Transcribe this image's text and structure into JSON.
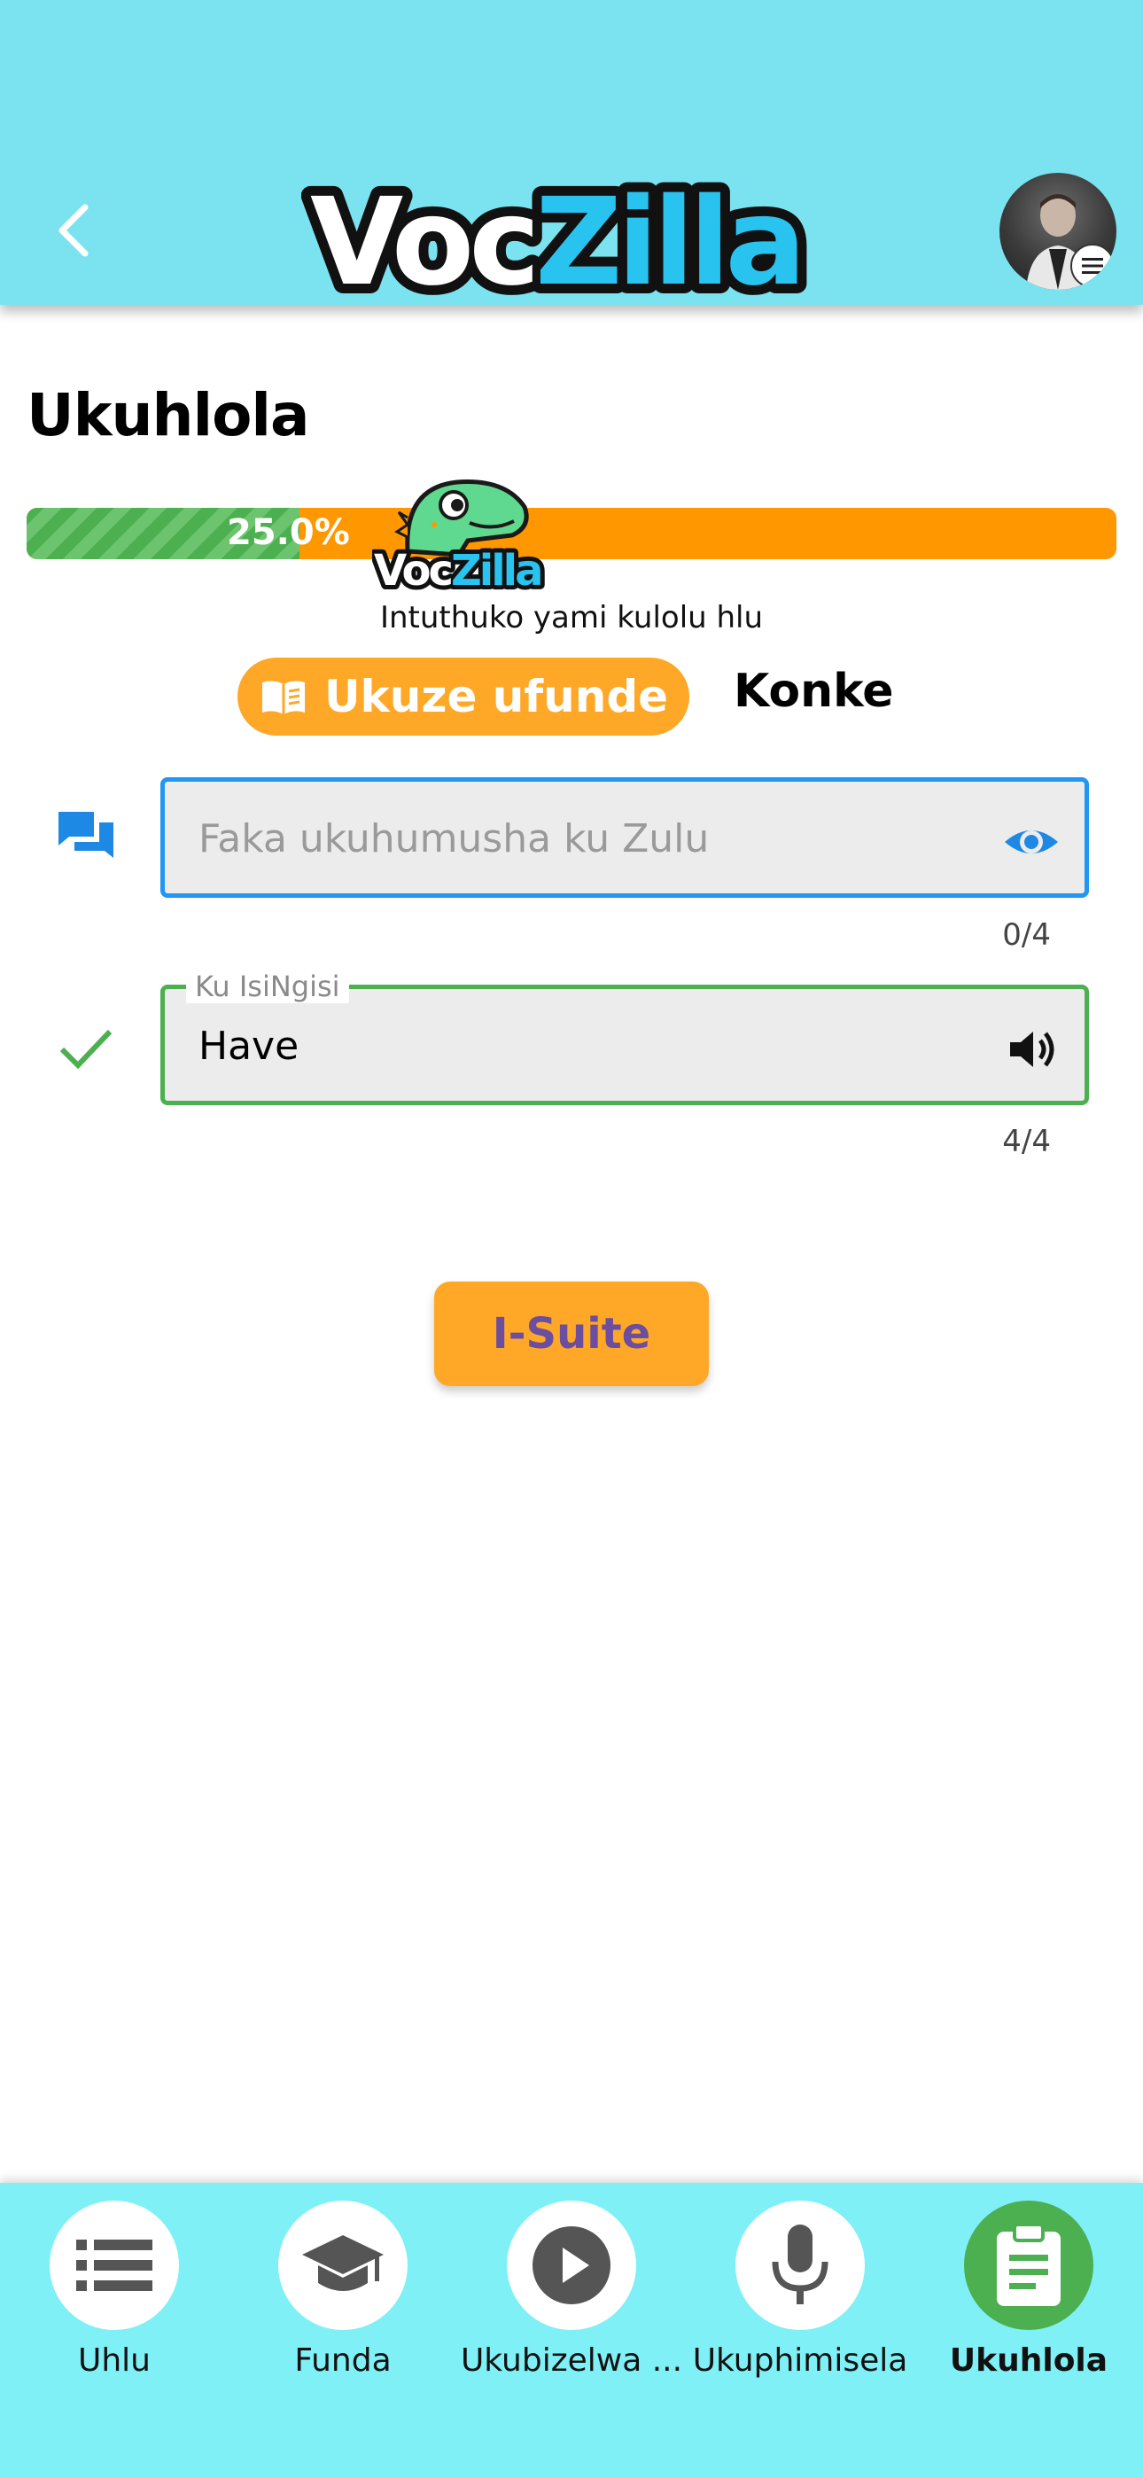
{
  "header": {
    "brand_part1": "Voc",
    "brand_part2": "Zilla",
    "back_icon": "chevron-left-icon",
    "avatar_badge_icon": "menu-icon",
    "colors": {
      "background": "#7be3ef",
      "brand_white": "#ffffff",
      "brand_blue": "#29c3f0"
    }
  },
  "page": {
    "title": "Ukuhlola"
  },
  "progress": {
    "value_percent": 25.0,
    "label": "25.0%",
    "caption": "Intuthuko yami kulolu hlu",
    "mascot_text_part1": "Voc",
    "mascot_text_part2": "Zilla",
    "colors": {
      "done": "#4caf50",
      "remaining": "#ff9800"
    }
  },
  "mode_toggle": {
    "active_label": "Ukuze ufunde",
    "active_icon": "book-icon",
    "inactive_label": "Konke"
  },
  "translation_field": {
    "placeholder": "Faka ukuhumusha ku Zulu",
    "value": "",
    "counter": "0/4",
    "row_icon": "chat-icon",
    "trail_icon": "eye-icon"
  },
  "english_field": {
    "label": "Ku IsiNgisi",
    "value": "Have",
    "counter": "4/4",
    "row_icon": "check-icon",
    "trail_icon": "speaker-icon"
  },
  "submit": {
    "label": "I-Suite"
  },
  "bottom_nav": {
    "items": [
      {
        "label": "Uhlu",
        "icon": "list-icon",
        "active": false
      },
      {
        "label": "Funda",
        "icon": "graduation-cap-icon",
        "active": false
      },
      {
        "label": "Ukubizelwa ...",
        "icon": "play-icon",
        "active": false
      },
      {
        "label": "Ukuphimisela",
        "icon": "microphone-icon",
        "active": false
      },
      {
        "label": "Ukuhlola",
        "icon": "clipboard-icon",
        "active": true
      }
    ]
  }
}
